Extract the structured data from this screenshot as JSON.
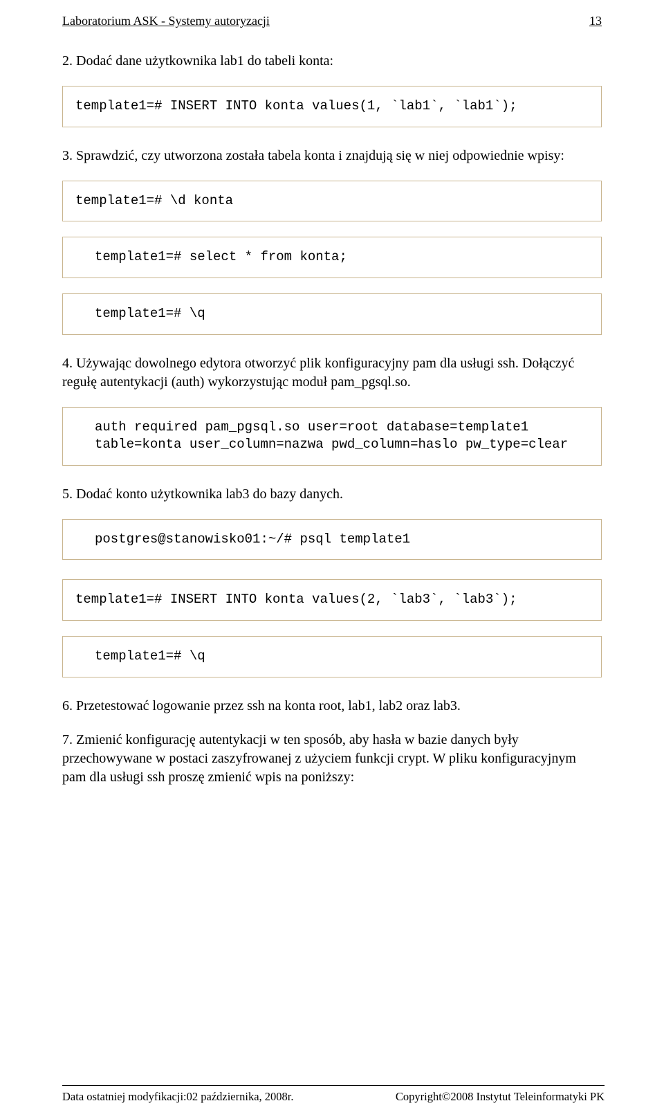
{
  "header": {
    "left": "Laboratorium ASK  -  Systemy autoryzacji",
    "right": "13"
  },
  "body": {
    "p1": "2. Dodać dane użytkownika lab1 do tabeli konta:",
    "code1": "template1=# INSERT INTO konta values(1, `lab1`, `lab1`);",
    "p2": "3. Sprawdzić, czy utworzona została tabela konta i znajdują się w niej odpowiednie wpisy:",
    "code2": "template1=# \\d konta",
    "code3": "template1=# select * from konta;",
    "code4": "template1=# \\q",
    "p3": "4. Używając dowolnego edytora otworzyć plik konfiguracyjny pam dla usługi ssh. Dołączyć regułę autentykacji (auth) wykorzystując moduł pam_pgsql.so.",
    "code5": "auth required pam_pgsql.so user=root database=template1 table=konta user_column=nazwa pwd_column=haslo pw_type=clear",
    "p4": "5. Dodać konto użytkownika lab3 do bazy danych.",
    "code6": "postgres@stanowisko01:~/# psql template1",
    "code7": "template1=# INSERT INTO konta values(2, `lab3`, `lab3`);",
    "code8": "template1=# \\q",
    "p5": "6. Przetestować logowanie przez ssh na konta root, lab1, lab2 oraz lab3.",
    "p6": "7. Zmienić konfigurację autentykacji w ten sposób, aby hasła w bazie danych były przechowywane w postaci zaszyfrowanej z użyciem funkcji crypt. W pliku konfiguracyjnym pam dla usługi ssh proszę zmienić wpis na poniższy:"
  },
  "footer": {
    "left": "Data ostatniej modyfikacji:02 października, 2008r.",
    "right": "Copyright©2008 Instytut Teleinformatyki PK"
  }
}
